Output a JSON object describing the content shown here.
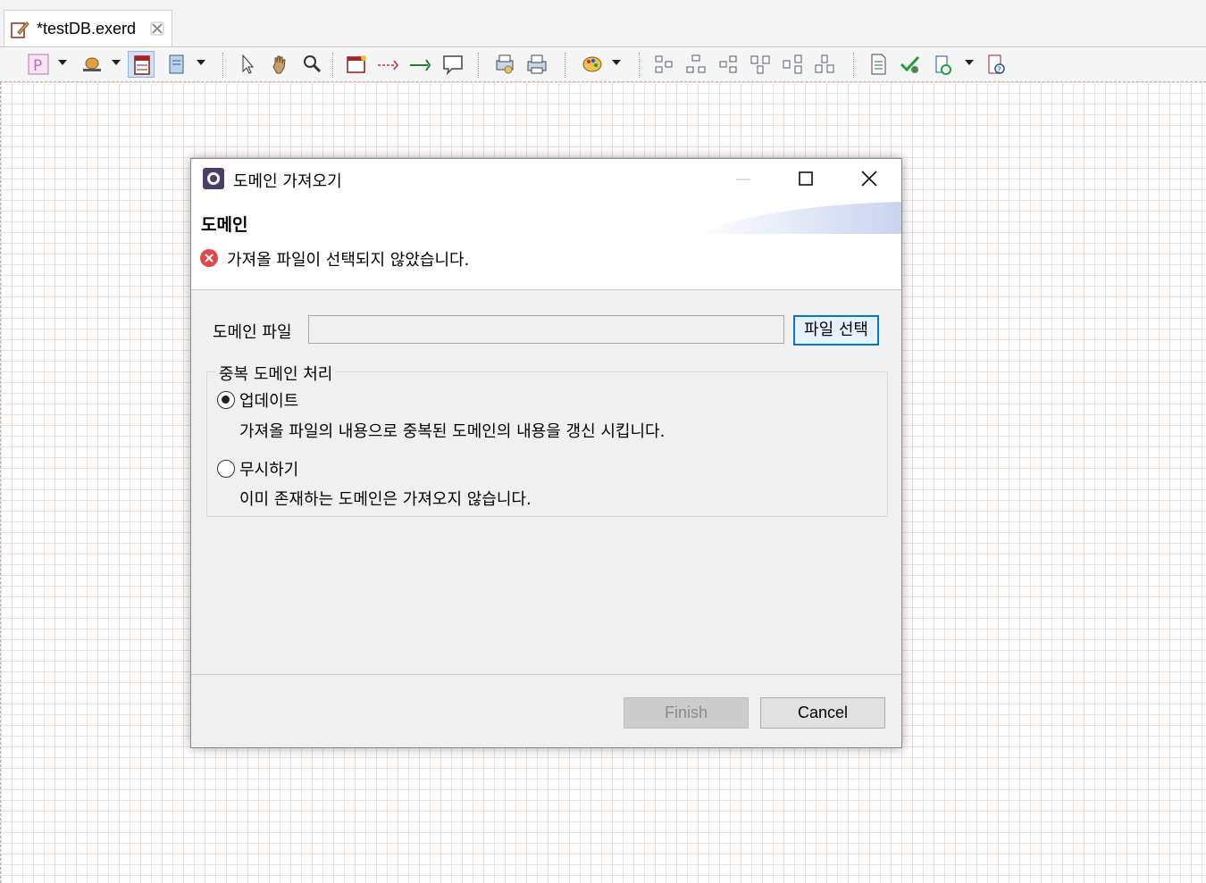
{
  "editor_tab": {
    "title": "*testDB.exerd"
  },
  "toolbar": {
    "icons": [
      "palette-p-icon",
      "model-icon",
      "table-icon",
      "note-icon",
      "select-arrow-icon",
      "hand-pan-icon",
      "zoom-icon",
      "new-entity-icon",
      "non-identifying-relation-icon",
      "identifying-relation-icon",
      "comment-icon",
      "print-preview-icon",
      "print-icon",
      "color-theme-icon",
      "align-icons",
      "document-icon",
      "validate-icon",
      "sync-icon",
      "help-icon"
    ]
  },
  "dialog": {
    "title": "도메인 가져오기",
    "header_title": "도메인",
    "error_message": "가져올 파일이 선택되지 않았습니다.",
    "file_label": "도메인 파일",
    "file_value": "",
    "select_file_button": "파일 선택",
    "group_title": "중복 도메인 처리",
    "options": [
      {
        "label": "업데이트",
        "description": "가져올 파일의 내용으로 중복된 도메인의 내용을 갱신 시킵니다.",
        "selected": true
      },
      {
        "label": "무시하기",
        "description": "이미 존재하는 도메인은 가져오지 않습니다.",
        "selected": false
      }
    ],
    "finish_button": "Finish",
    "cancel_button": "Cancel"
  }
}
